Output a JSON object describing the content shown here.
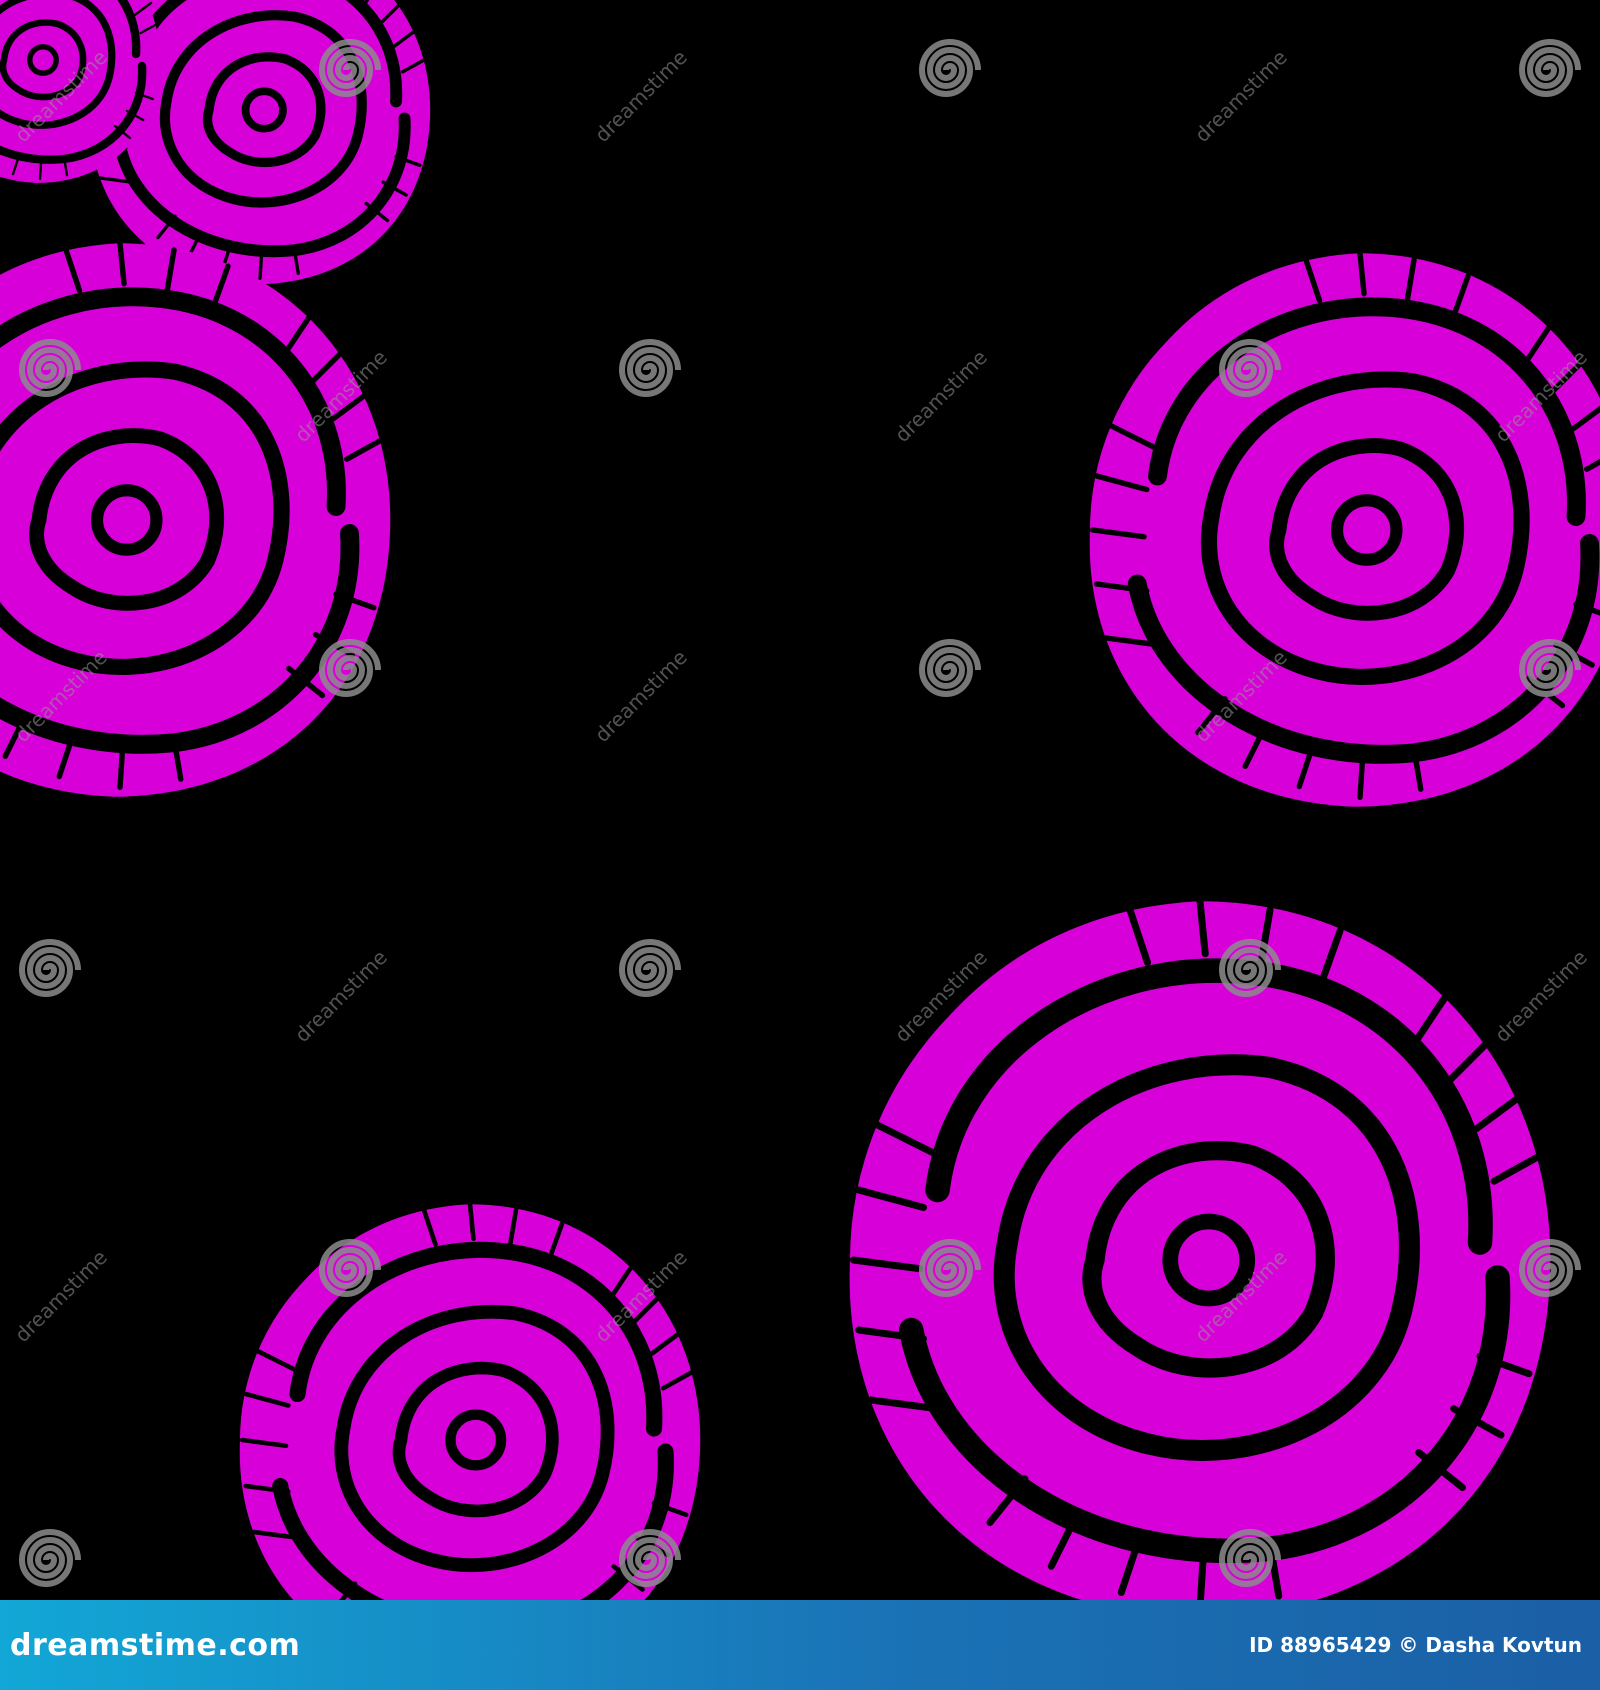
{
  "watermark": {
    "brand": "dreamstime",
    "tile_text": "dreamstime"
  },
  "footer": {
    "site": "dreamstime.com",
    "credit": "ID 88965429 © Dasha Kovtun"
  },
  "colors": {
    "background": "#000000",
    "rose": "#d800d8",
    "watermark": "#8c8c8c",
    "footer_start": "#12a7d6",
    "footer_end": "#1b5fa6"
  },
  "icons": {
    "watermark_swirl": "dreamstime-swirl-icon"
  }
}
